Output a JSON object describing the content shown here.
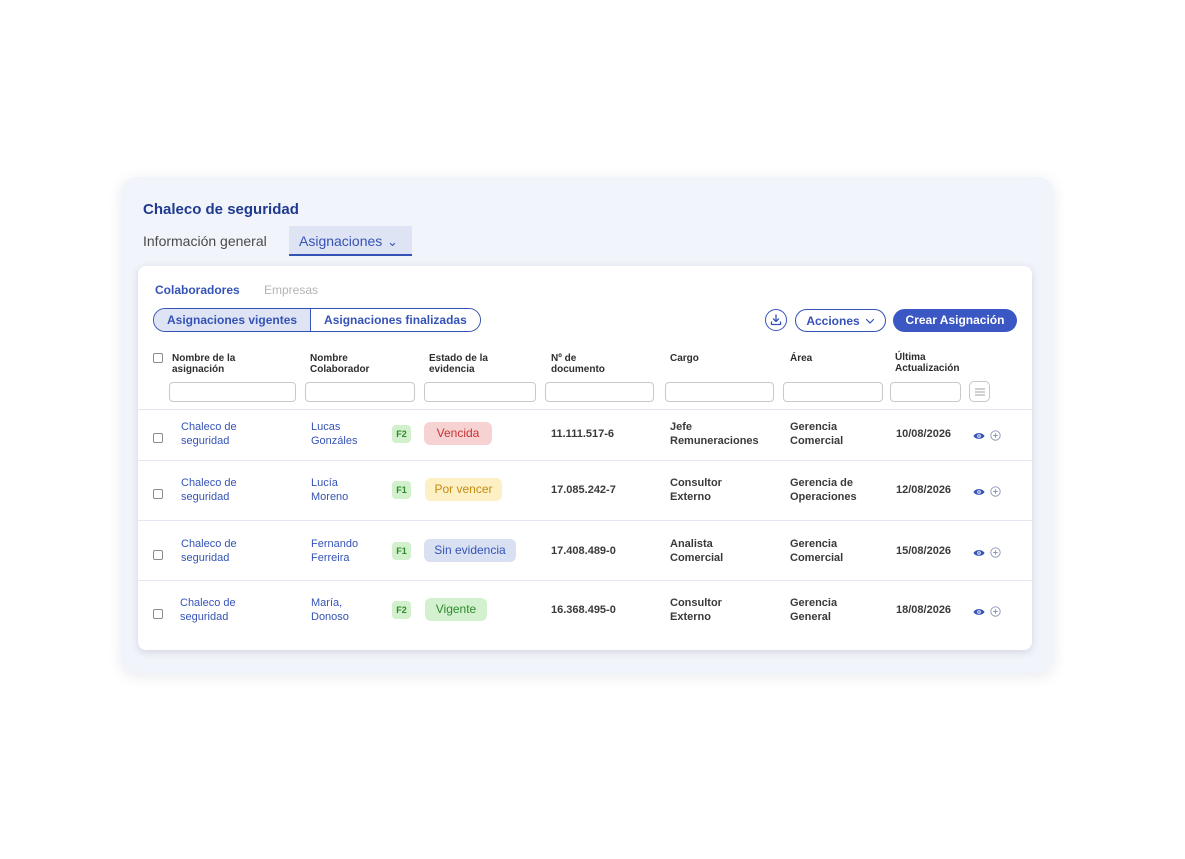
{
  "page": {
    "title": "Chaleco de seguridad",
    "tabs": [
      "Información general",
      "Asignaciones"
    ],
    "active_tab_chevron": "⌄"
  },
  "subtabs": [
    "Colaboradores",
    "Empresas"
  ],
  "segments": [
    "Asignaciones vigentes",
    "Asignaciones finalizadas"
  ],
  "toolbar": {
    "download_icon": "download-icon",
    "acciones_label": "Acciones",
    "crear_label": "Crear Asignación"
  },
  "table": {
    "headers": {
      "nombre_asignacion": [
        "Nombre de la",
        "asignación"
      ],
      "nombre_colaborador": [
        "Nombre",
        "Colaborador"
      ],
      "estado": [
        "Estado de la",
        "evidencia"
      ],
      "documento": [
        "Nº de",
        "documento"
      ],
      "cargo": [
        "Cargo"
      ],
      "area": [
        "Área"
      ],
      "ultima": [
        "Última",
        "Actualización"
      ]
    },
    "rows": [
      {
        "asignacion": [
          "Chaleco de",
          "seguridad"
        ],
        "colaborador": [
          "Lucas",
          "Gonzáles"
        ],
        "badge": "F2",
        "estado": "Vencida",
        "documento": "11.111.517-6",
        "cargo": [
          "Jefe",
          "Remuneraciones"
        ],
        "area": [
          "Gerencia",
          "Comercial"
        ],
        "fecha": "10/08/2026"
      },
      {
        "asignacion": [
          "Chaleco de",
          "seguridad"
        ],
        "colaborador": [
          "Lucía",
          "Moreno"
        ],
        "badge": "F1",
        "estado": "Por vencer",
        "documento": "17.085.242-7",
        "cargo": [
          "Consultor",
          "Externo"
        ],
        "area": [
          "Gerencia de",
          "Operaciones"
        ],
        "fecha": "12/08/2026"
      },
      {
        "asignacion": [
          "Chaleco de",
          "seguridad"
        ],
        "colaborador": [
          "Fernando",
          "Ferreira"
        ],
        "badge": "F1",
        "estado": "Sin evidencia",
        "documento": "17.408.489-0",
        "cargo": [
          "Analista",
          "Comercial"
        ],
        "area": [
          "Gerencia",
          "Comercial"
        ],
        "fecha": "15/08/2026"
      },
      {
        "asignacion": [
          "Chaleco de",
          "seguridad"
        ],
        "colaborador": [
          "María,",
          "Donoso"
        ],
        "badge": "F2",
        "estado": "Vigente",
        "documento": "16.368.495-0",
        "cargo": [
          "Consultor",
          "Externo"
        ],
        "area": [
          "Gerencia",
          "General"
        ],
        "fecha": "18/08/2026"
      }
    ]
  },
  "status_colors": {
    "Vencida": {
      "bg": "#f6d2d2",
      "fg": "#c93232"
    },
    "Por vencer": {
      "bg": "#fdf0c4",
      "fg": "#c48a10"
    },
    "Sin evidencia": {
      "bg": "#d8e0f2",
      "fg": "#3553b6"
    },
    "Vigente": {
      "bg": "#d3f0cf",
      "fg": "#2c8a2c"
    }
  },
  "colors": {
    "accent": "#3553b6",
    "button_primary": "#3b57c4",
    "panel_bg": "#f2f4fb"
  }
}
